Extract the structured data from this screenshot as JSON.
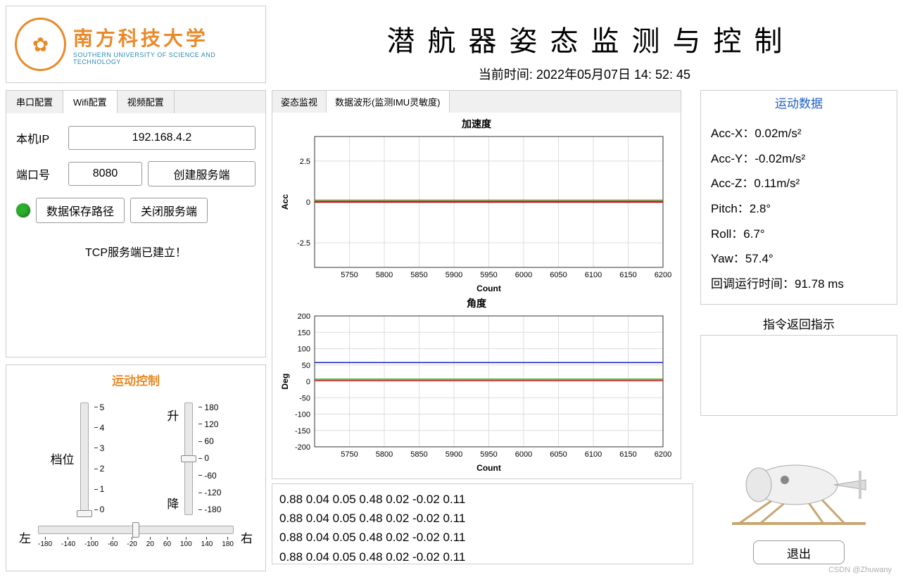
{
  "logo": {
    "cn": "南方科技大学",
    "en": "SOUTHERN UNIVERSITY OF SCIENCE AND TECHNOLOGY"
  },
  "title": "潜航器姿态监测与控制",
  "time_label": "当前时间: 2022年05月07日 14: 52: 45",
  "config_tabs": [
    "串口配置",
    "Wifi配置",
    "视频配置"
  ],
  "wifi": {
    "ip_label": "本机IP",
    "ip_value": "192.168.4.2",
    "port_label": "端口号",
    "port_value": "8080",
    "create_server": "创建服务端",
    "save_path": "数据保存路径",
    "close_server": "关闭服务端",
    "status": "TCP服务端已建立！"
  },
  "motion_control": {
    "title": "运动控制",
    "gear_label": "档位",
    "up_label": "升",
    "down_label": "降",
    "left_label": "左",
    "right_label": "右",
    "gear_ticks": [
      "5",
      "4",
      "3",
      "2",
      "1",
      "0"
    ],
    "updown_ticks": [
      "180",
      "120",
      "60",
      "0",
      "-60",
      "-120",
      "-180"
    ],
    "lr_ticks": [
      "-180",
      "-140",
      "-100",
      "-60",
      "-20",
      "20",
      "60",
      "100",
      "140",
      "180"
    ]
  },
  "chart_tabs": [
    "姿态监视",
    "数据波形(监测IMU灵敏度)"
  ],
  "chart_data": [
    {
      "type": "line",
      "title": "加速度",
      "xlabel": "Count",
      "ylabel": "Acc",
      "xlim": [
        5700,
        6200
      ],
      "ylim": [
        -4,
        4
      ],
      "xticks": [
        5750,
        5800,
        5850,
        5900,
        5950,
        6000,
        6050,
        6100,
        6150,
        6200
      ],
      "yticks": [
        -2.5,
        0,
        2.5
      ],
      "series": [
        {
          "name": "AccX",
          "color": "#1020c0",
          "x": [
            5700,
            6200
          ],
          "y": [
            0.02,
            0.02
          ]
        },
        {
          "name": "AccY",
          "color": "#d02020",
          "x": [
            5700,
            6200
          ],
          "y": [
            -0.02,
            -0.02
          ]
        },
        {
          "name": "AccZ",
          "color": "#808000",
          "x": [
            5700,
            6200
          ],
          "y": [
            0.11,
            0.11
          ]
        }
      ]
    },
    {
      "type": "line",
      "title": "角度",
      "xlabel": "Count",
      "ylabel": "Deg",
      "xlim": [
        5700,
        6200
      ],
      "ylim": [
        -200,
        200
      ],
      "xticks": [
        5750,
        5800,
        5850,
        5900,
        5950,
        6000,
        6050,
        6100,
        6150,
        6200
      ],
      "yticks": [
        -200,
        -150,
        -100,
        -50,
        0,
        50,
        100,
        150,
        200
      ],
      "series": [
        {
          "name": "Yaw",
          "color": "#1020c0",
          "x": [
            5700,
            6200
          ],
          "y": [
            57.4,
            57.4
          ]
        },
        {
          "name": "Roll",
          "color": "#20a020",
          "x": [
            5700,
            6200
          ],
          "y": [
            6.7,
            6.7
          ]
        },
        {
          "name": "Pitch",
          "color": "#d02020",
          "x": [
            5700,
            6200
          ],
          "y": [
            2.8,
            2.8
          ]
        }
      ]
    }
  ],
  "log_lines": [
    "0.88 0.04 0.05 0.48 0.02 -0.02 0.11",
    "0.88 0.04 0.05 0.48 0.02 -0.02 0.11",
    "0.88 0.04 0.05 0.48 0.02 -0.02 0.11",
    "0.88 0.04 0.05 0.48 0.02 -0.02 0.11"
  ],
  "motion_data": {
    "title": "运动数据",
    "items": [
      {
        "label": "Acc-X：",
        "value": "0.02m/s²"
      },
      {
        "label": "Acc-Y：",
        "value": "-0.02m/s²"
      },
      {
        "label": "Acc-Z：",
        "value": "0.11m/s²"
      },
      {
        "label": "Pitch：",
        "value": "2.8°"
      },
      {
        "label": "Roll：",
        "value": "6.7°"
      },
      {
        "label": "Yaw：",
        "value": "57.4°"
      },
      {
        "label": "回调运行时间：",
        "value": "91.78 ms"
      }
    ]
  },
  "cmd_return": "指令返回指示",
  "exit": "退出",
  "watermark": "CSDN @Zhuwany"
}
